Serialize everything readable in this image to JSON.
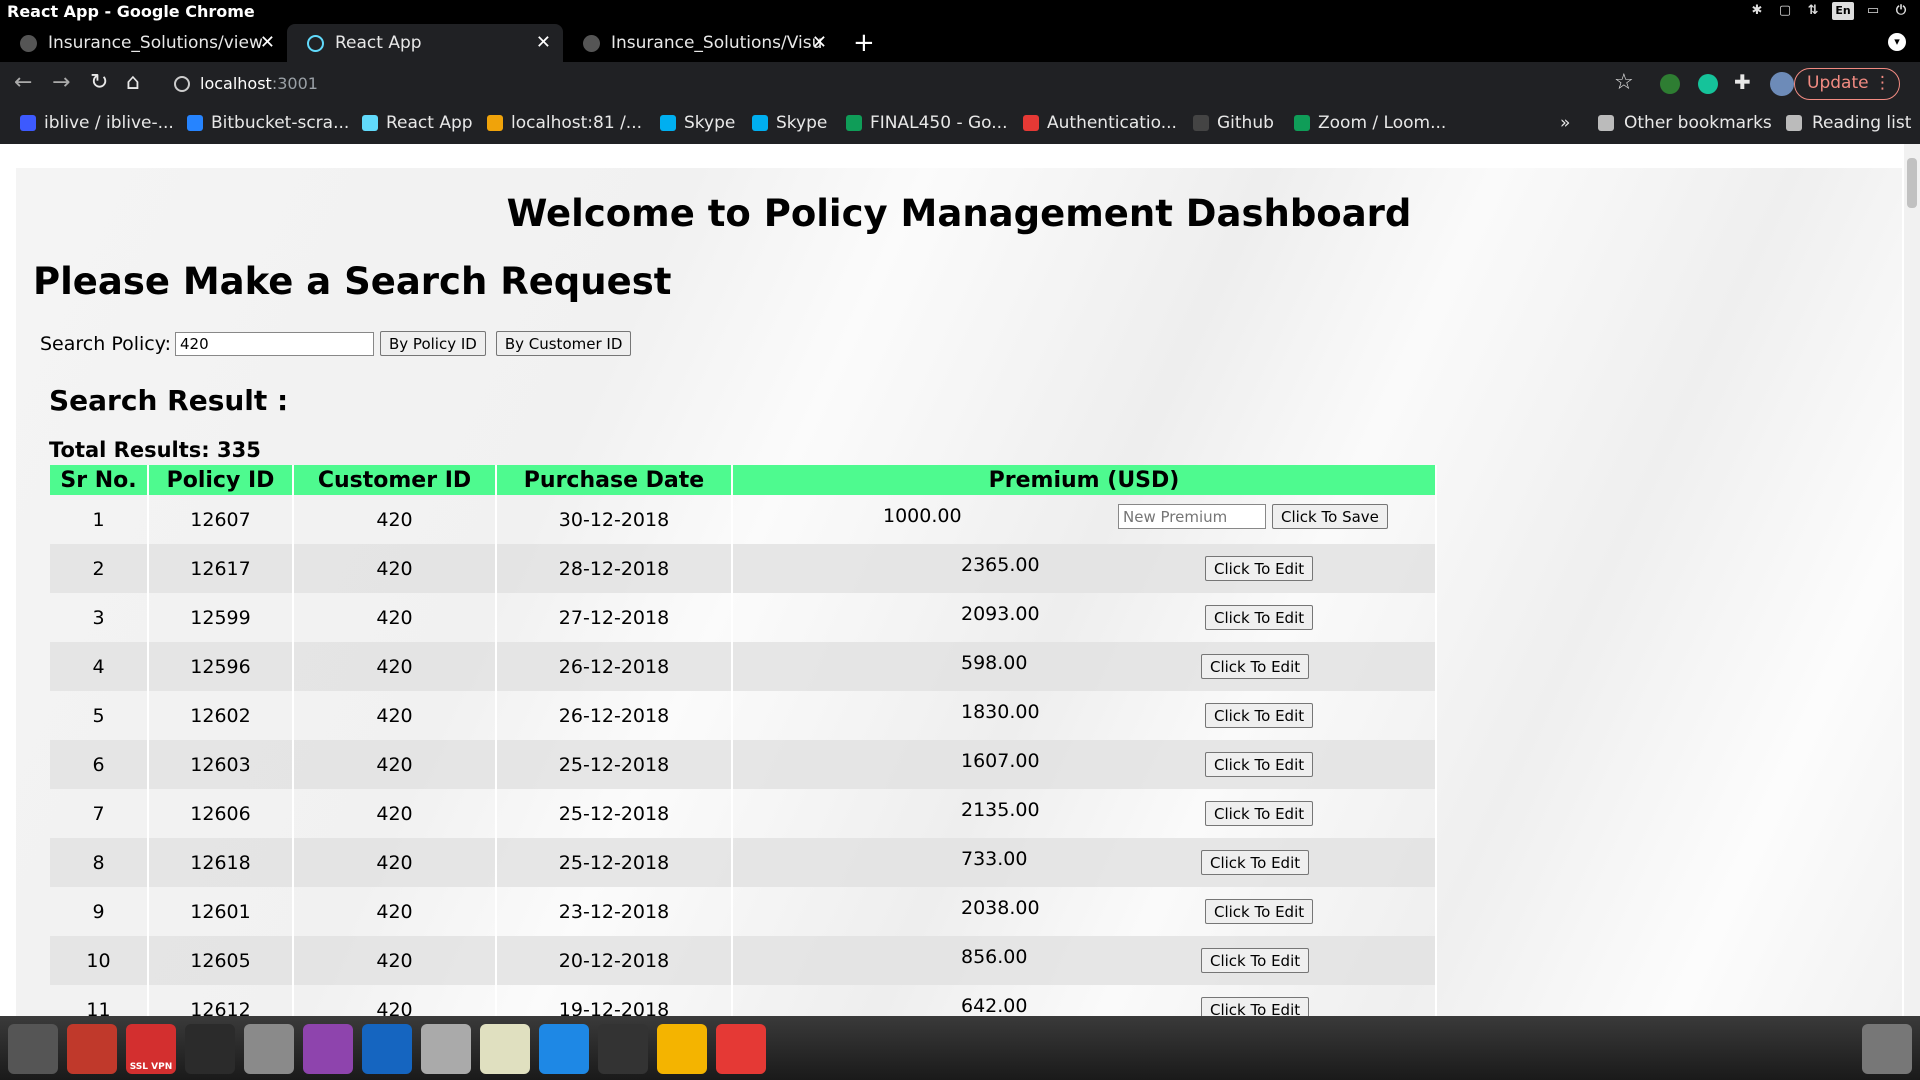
{
  "window": {
    "title": "React App - Google Chrome"
  },
  "tabs": [
    {
      "label": "Insurance_Solutions/view",
      "active": false
    },
    {
      "label": "React App",
      "active": true
    },
    {
      "label": "Insurance_Solutions/Visu",
      "active": false
    }
  ],
  "toolbar": {
    "url_host": "localhost",
    "url_port": ":3001",
    "update_label": "Update"
  },
  "bookmarks": [
    {
      "label": "iblive / iblive-...",
      "color": "#3d5afe"
    },
    {
      "label": "Bitbucket-scra...",
      "color": "#2684ff"
    },
    {
      "label": "React App",
      "color": "#61dafb"
    },
    {
      "label": "localhost:81 /...",
      "color": "#f0a30a"
    },
    {
      "label": "Skype",
      "color": "#00aff0"
    },
    {
      "label": "Skype",
      "color": "#00aff0"
    },
    {
      "label": "FINAL450 - Go...",
      "color": "#0f9d58"
    },
    {
      "label": "Authenticatio...",
      "color": "#e53935"
    },
    {
      "label": "Github",
      "color": "#444444"
    },
    {
      "label": "Zoom / Loom...",
      "color": "#0f9d58"
    }
  ],
  "bookmarks_extra": {
    "overflow": "»",
    "other": "Other bookmarks",
    "reading": "Reading list"
  },
  "page": {
    "title": "Welcome to Policy Management Dashboard",
    "subtitle": "Please Make a Search Request",
    "search_label": "Search Policy:",
    "search_value": "420",
    "by_policy_btn": "By Policy ID",
    "by_customer_btn": "By Customer ID",
    "result_title": "Search Result :",
    "total_results": "Total Results: 335",
    "new_premium_placeholder": "New Premium",
    "save_label": "Click To Save",
    "edit_label": "Click To Edit"
  },
  "table": {
    "headers": [
      "Sr No.",
      "Policy ID",
      "Customer ID",
      "Purchase Date",
      "Premium (USD)"
    ],
    "rows": [
      {
        "sr": "1",
        "policy": "12607",
        "customer": "420",
        "date": "30-12-2018",
        "premium": "1000.00",
        "editing": true
      },
      {
        "sr": "2",
        "policy": "12617",
        "customer": "420",
        "date": "28-12-2018",
        "premium": "2365.00"
      },
      {
        "sr": "3",
        "policy": "12599",
        "customer": "420",
        "date": "27-12-2018",
        "premium": "2093.00"
      },
      {
        "sr": "4",
        "policy": "12596",
        "customer": "420",
        "date": "26-12-2018",
        "premium": "598.00"
      },
      {
        "sr": "5",
        "policy": "12602",
        "customer": "420",
        "date": "26-12-2018",
        "premium": "1830.00"
      },
      {
        "sr": "6",
        "policy": "12603",
        "customer": "420",
        "date": "25-12-2018",
        "premium": "1607.00"
      },
      {
        "sr": "7",
        "policy": "12606",
        "customer": "420",
        "date": "25-12-2018",
        "premium": "2135.00"
      },
      {
        "sr": "8",
        "policy": "12618",
        "customer": "420",
        "date": "25-12-2018",
        "premium": "733.00"
      },
      {
        "sr": "9",
        "policy": "12601",
        "customer": "420",
        "date": "23-12-2018",
        "premium": "2038.00"
      },
      {
        "sr": "10",
        "policy": "12605",
        "customer": "420",
        "date": "20-12-2018",
        "premium": "856.00"
      },
      {
        "sr": "11",
        "policy": "12612",
        "customer": "420",
        "date": "19-12-2018",
        "premium": "642.00"
      }
    ]
  },
  "tray": {
    "lang": "En"
  },
  "taskbar": {
    "items": [
      {
        "name": "settings",
        "color": "#555555"
      },
      {
        "name": "archive",
        "color": "#c0392b"
      },
      {
        "name": "ssl-vpn",
        "color": "#d32f2f",
        "label": "SSL VPN"
      },
      {
        "name": "terminal",
        "color": "#2b2b2b"
      },
      {
        "name": "drive",
        "color": "#8a8a8a"
      },
      {
        "name": "media",
        "color": "#8e44ad"
      },
      {
        "name": "bluetooth",
        "color": "#1565c0"
      },
      {
        "name": "disk",
        "color": "#aaaaaa"
      },
      {
        "name": "text-editor",
        "color": "#e0e0c0"
      },
      {
        "name": "vscode",
        "color": "#1e88e5"
      },
      {
        "name": "workspace",
        "color": "#333333"
      },
      {
        "name": "chrome",
        "color": "#f4b400"
      },
      {
        "name": "pdf",
        "color": "#e53935"
      }
    ]
  }
}
